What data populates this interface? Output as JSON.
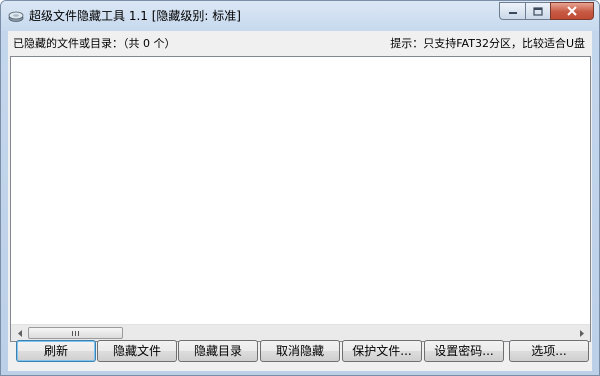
{
  "window": {
    "title": "超级文件隐藏工具 1.1  [隐藏级别: 标准]",
    "icon": "hard-drive-icon",
    "controls": [
      "minimize-icon",
      "maximize-icon",
      "close-icon"
    ]
  },
  "status": {
    "hidden_count_label": "已隐藏的文件或目录：（共 0 个）",
    "hint": "提示：只支持FAT32分区，比较适合U盘"
  },
  "list": {
    "items": []
  },
  "buttons": {
    "refresh": "刷新",
    "hide_file": "隐藏文件",
    "hide_dir": "隐藏目录",
    "unhide": "取消隐藏",
    "protect_file": "保护文件...",
    "set_password": "设置密码...",
    "options": "选项..."
  },
  "colors": {
    "title_bar": "#c7d9ee",
    "close_button": "#c75a43",
    "dialog_bg": "#f0f0f0"
  }
}
